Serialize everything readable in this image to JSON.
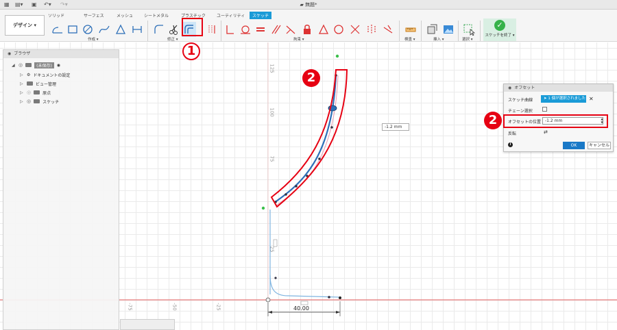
{
  "window": {
    "title": "無題*",
    "title_icon": "cube-icon"
  },
  "ribbon": {
    "tabs": [
      "ソリッド",
      "サーフェス",
      "メッシュ",
      "シートメタル",
      "プラスチック",
      "ユーティリティ",
      "スケッチ"
    ],
    "active_tab": "スケッチ",
    "workspace_button": "デザイン ▾",
    "groups": {
      "create": "作成 ▾",
      "modify": "修正 ▾",
      "constraints": "拘束 ▾",
      "inspect": "検査 ▾",
      "insert": "挿入 ▾",
      "select": "選択 ▾"
    },
    "finish_sketch": "スケッチを終了 ▾"
  },
  "browser": {
    "title": "ブラウザ",
    "root_label": "(未保存)",
    "items": [
      "ドキュメントの設定",
      "ビュー管理",
      "原点",
      "スケッチ"
    ]
  },
  "canvas": {
    "ruler_vertical": [
      "125",
      "100",
      "75",
      "25"
    ],
    "ruler_horizontal": [
      "-75",
      "-50",
      "-25"
    ],
    "dimension": "40.00",
    "floating_value": "-1.2 mm"
  },
  "offset_dialog": {
    "title": "オフセット",
    "sketch_curve_label": "スケッチ曲線",
    "selection_text": "1 個が選択されました",
    "chain_select_label": "チェーン選択",
    "offset_position_label": "オフセットの位置",
    "offset_value": "-1.2 mm",
    "flip_label": "反転",
    "ok_label": "OK",
    "cancel_label": "キャンセル"
  },
  "annotations": {
    "callout_1": "1",
    "callout_2": "2",
    "highlight_color": "#e60012"
  },
  "colors": {
    "accent": "#1a9bd7",
    "ok": "#1a79c7",
    "finish": "#36b24a",
    "curve": "#4a8fd4",
    "axis": "#e35a5a"
  }
}
